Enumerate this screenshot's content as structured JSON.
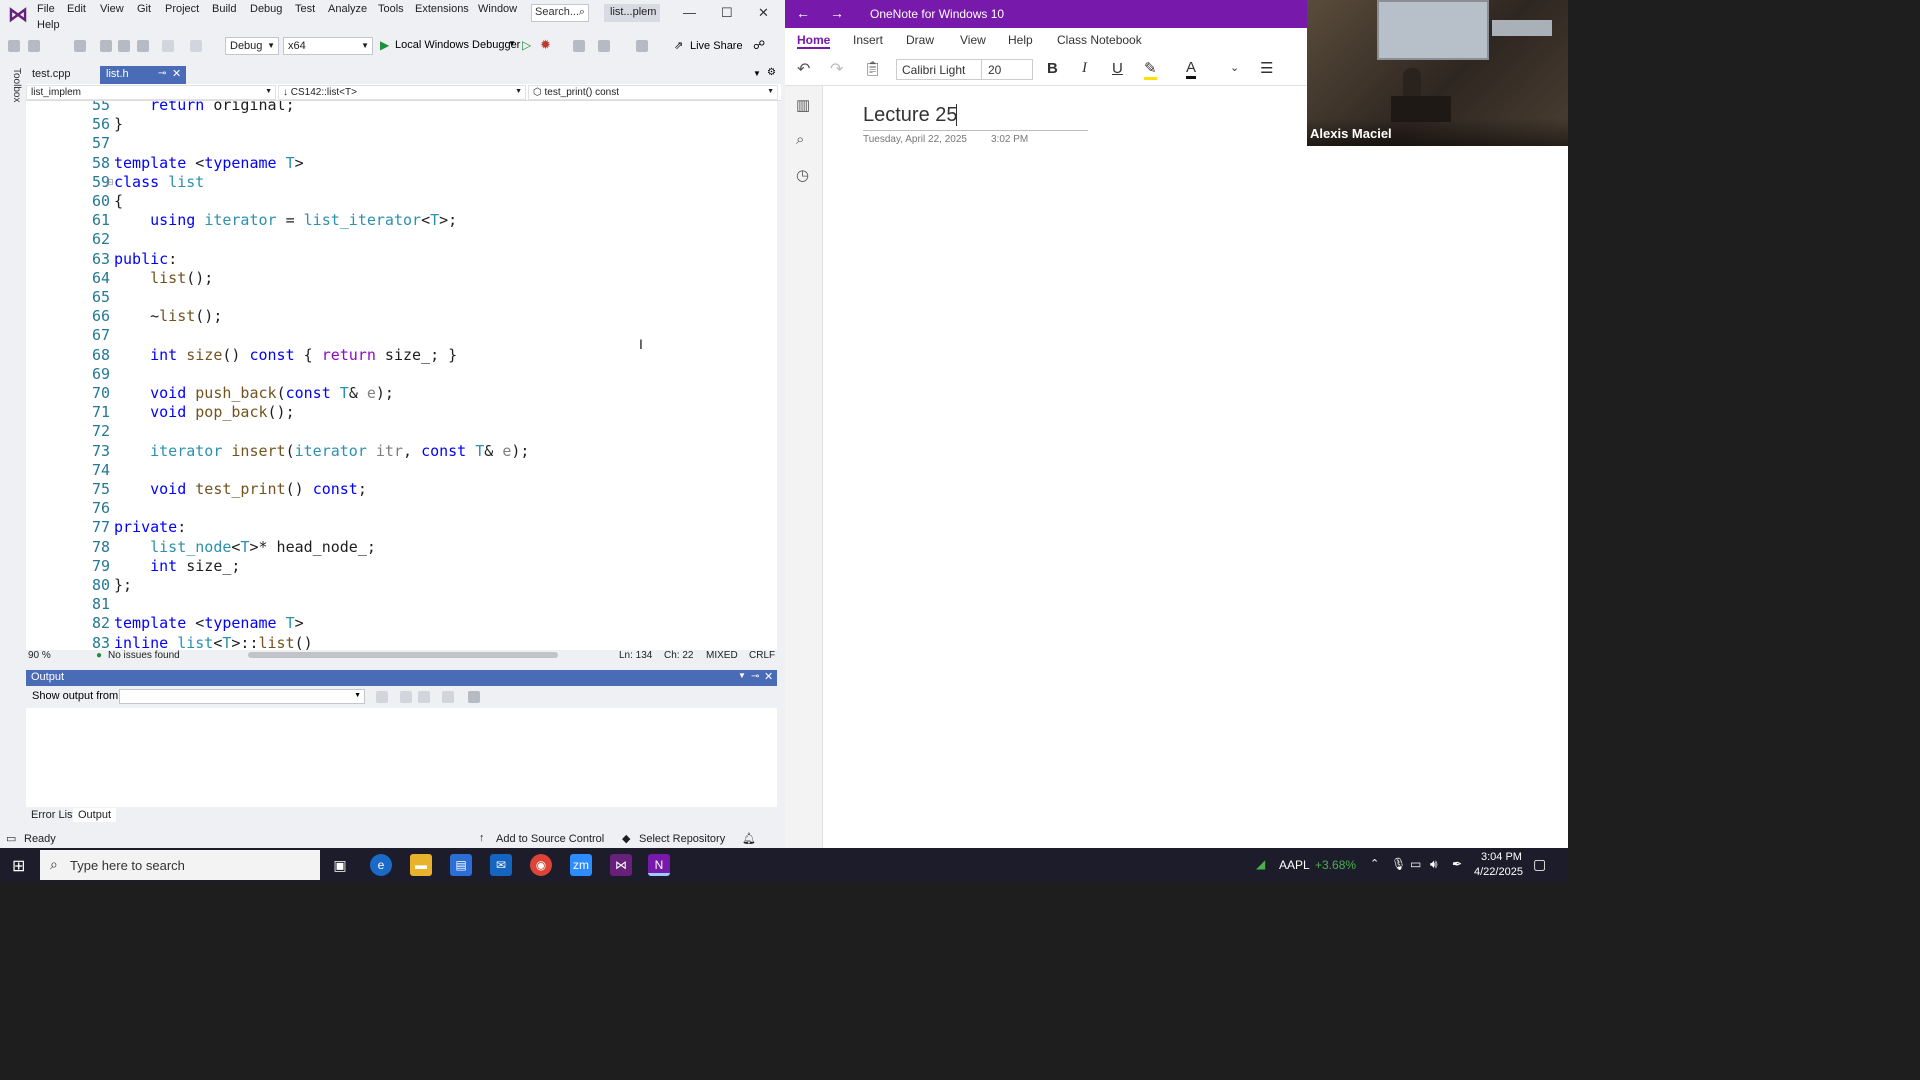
{
  "vs": {
    "menu": [
      "File",
      "Edit",
      "View",
      "Git",
      "Project",
      "Build",
      "Debug",
      "Test",
      "Analyze",
      "Tools",
      "Extensions",
      "Window",
      "Help"
    ],
    "search_label": "Search...",
    "solution_label": "list...plem",
    "toolbar": {
      "config": "Debug",
      "platform": "x64",
      "debugger": "Local Windows Debugger",
      "live_share": "Live Share"
    },
    "tabs": [
      {
        "label": "test.cpp",
        "active": false
      },
      {
        "label": "list.h",
        "active": true
      }
    ],
    "toolbox_label": "Toolbox",
    "navbar": {
      "project": "list_implem",
      "scope": "CS142::list<T>",
      "member": "test_print() const"
    },
    "code_lines": [
      {
        "n": "55",
        "t": "    return original;"
      },
      {
        "n": "56",
        "t": "}"
      },
      {
        "n": "57",
        "t": ""
      },
      {
        "n": "58",
        "t": "template <typename T>"
      },
      {
        "n": "59",
        "t": "class list"
      },
      {
        "n": "60",
        "t": "{"
      },
      {
        "n": "61",
        "t": "    using iterator = list_iterator<T>;"
      },
      {
        "n": "62",
        "t": ""
      },
      {
        "n": "63",
        "t": "public:"
      },
      {
        "n": "64",
        "t": "    list();"
      },
      {
        "n": "65",
        "t": ""
      },
      {
        "n": "66",
        "t": "    ~list();"
      },
      {
        "n": "67",
        "t": ""
      },
      {
        "n": "68",
        "t": "    int size() const { return size_; }"
      },
      {
        "n": "69",
        "t": ""
      },
      {
        "n": "70",
        "t": "    void push_back(const T& e);"
      },
      {
        "n": "71",
        "t": "    void pop_back();"
      },
      {
        "n": "72",
        "t": ""
      },
      {
        "n": "73",
        "t": "    iterator insert(iterator itr, const T& e);"
      },
      {
        "n": "74",
        "t": ""
      },
      {
        "n": "75",
        "t": "    void test_print() const;"
      },
      {
        "n": "76",
        "t": ""
      },
      {
        "n": "77",
        "t": "private:"
      },
      {
        "n": "78",
        "t": "    list_node<T>* head_node_;"
      },
      {
        "n": "79",
        "t": "    int size_;"
      },
      {
        "n": "80",
        "t": "};"
      },
      {
        "n": "81",
        "t": ""
      },
      {
        "n": "82",
        "t": "template <typename T>"
      },
      {
        "n": "83",
        "t": "inline list<T>::list()"
      }
    ],
    "editor_status": {
      "zoom": "90 %",
      "issues": "No issues found",
      "ln": "Ln: 134",
      "ch": "Ch: 22",
      "mixed": "MIXED",
      "crlf": "CRLF"
    },
    "output": {
      "title": "Output",
      "show_from": "Show output from:"
    },
    "bottom_tabs": [
      "Error List",
      "Output"
    ],
    "statusbar": {
      "ready": "Ready",
      "source_control": "Add to Source Control",
      "repository": "Select Repository"
    }
  },
  "onenote": {
    "app_title": "OneNote for Windows 10",
    "ribbon_tabs": [
      "Home",
      "Insert",
      "Draw",
      "View",
      "Help",
      "Class Notebook"
    ],
    "font_name": "Calibri Light",
    "font_size": "20",
    "page_title": "Lecture 25",
    "page_date": "Tuesday, April 22, 2025",
    "page_time": "3:02 PM"
  },
  "zoom": {
    "participant": "Alexis Maciel"
  },
  "taskbar": {
    "search_placeholder": "Type here to search",
    "stock_symbol": "AAPL",
    "stock_change": "+3.68%",
    "time": "3:04 PM",
    "date": "4/22/2025"
  },
  "colors": {
    "vs_accent": "#4a6bb6",
    "onenote_purple": "#7719aa",
    "keyword_blue": "#0000ff",
    "type_teal": "#2b91af"
  }
}
